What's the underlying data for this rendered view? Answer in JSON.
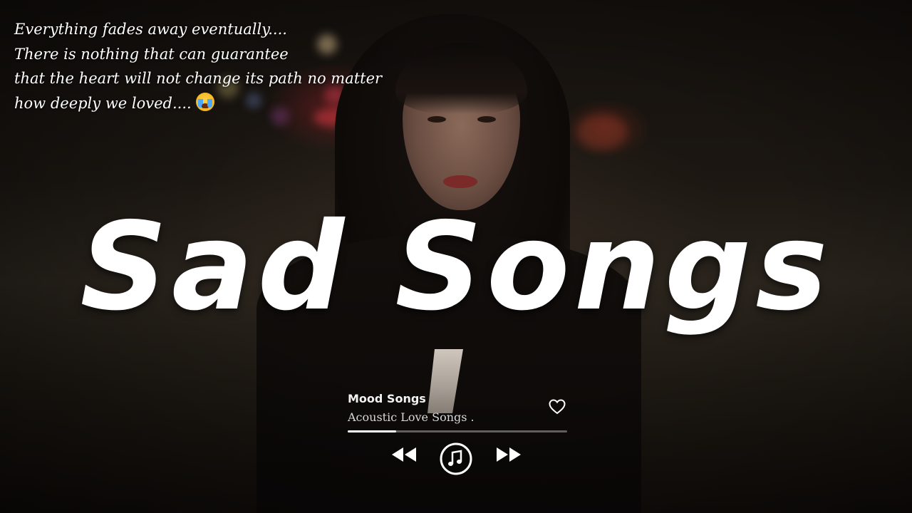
{
  "quote": {
    "lines": [
      "Everything fades away eventually....",
      "There is nothing that can guarantee",
      "that the heart will not change its path no matter",
      "how deeply we loved...."
    ],
    "emoji_icon": "crying-face-icon"
  },
  "title": "Sad Songs",
  "player": {
    "title": "Mood Songs",
    "subtitle": "Acoustic Love Songs .",
    "progress_fraction": 0.22,
    "icons": {
      "favorite": "heart-icon",
      "previous": "rewind-icon",
      "play": "music-note-icon",
      "next": "fast-forward-icon"
    }
  },
  "colors": {
    "text": "#ffffff",
    "progress_fill": "#ffffff",
    "progress_track": "#8c8c8c"
  }
}
